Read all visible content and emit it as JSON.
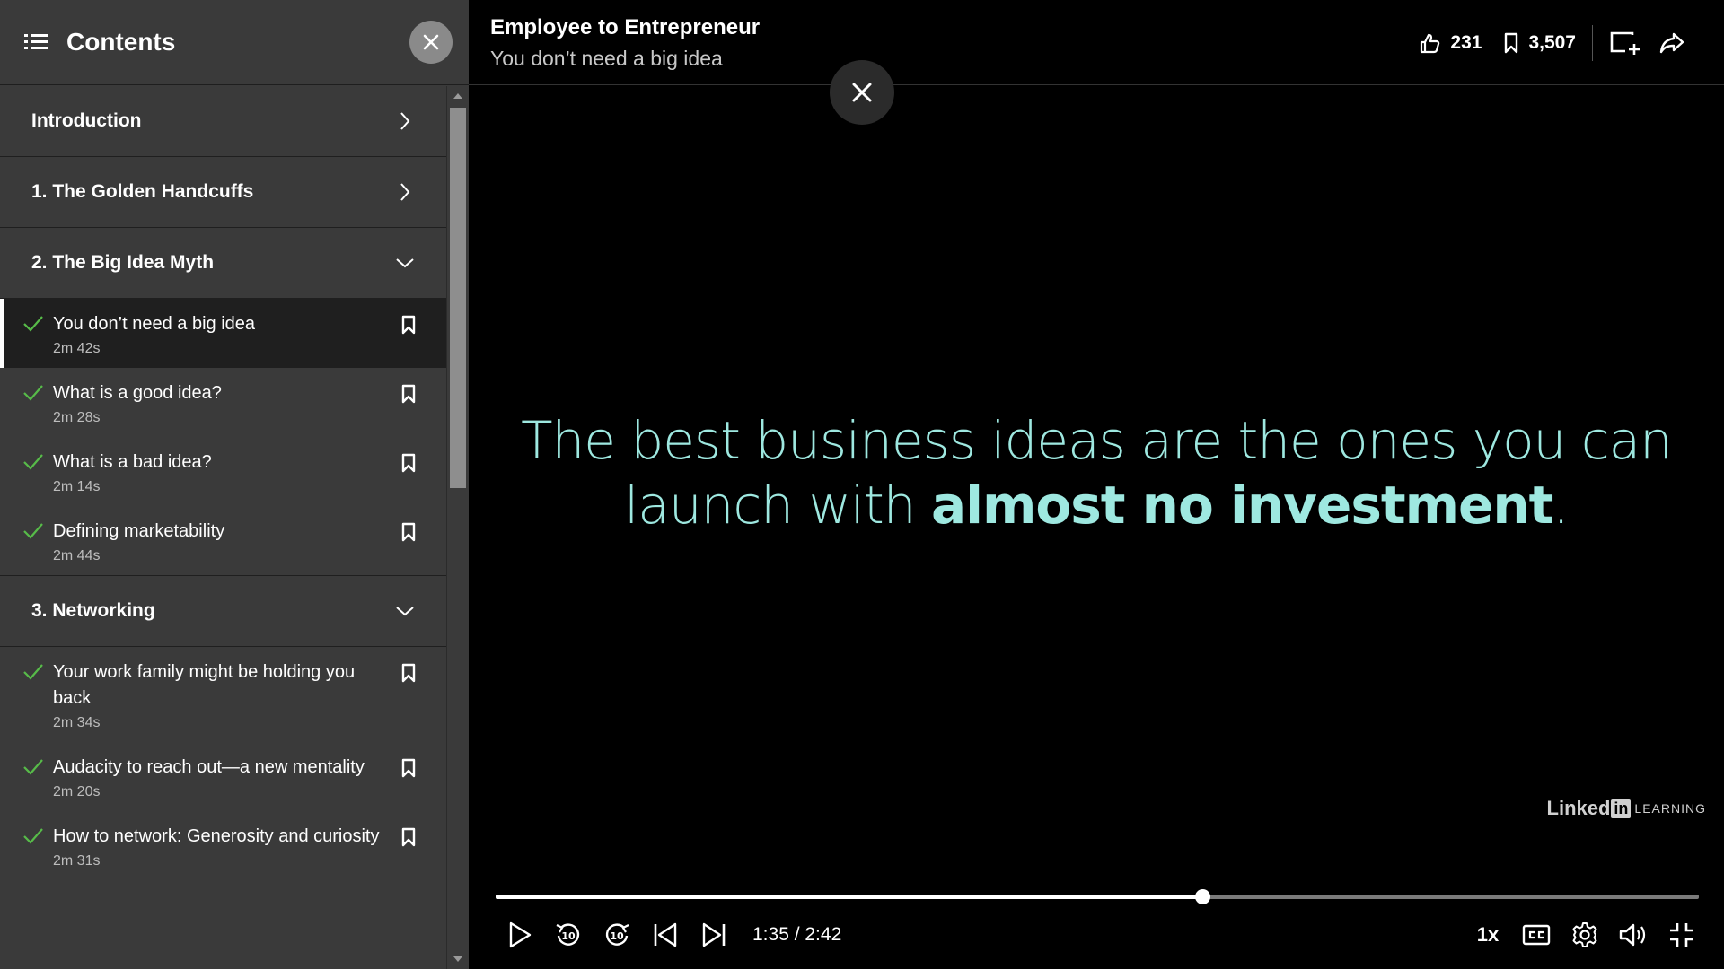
{
  "sidebar": {
    "title": "Contents",
    "sections": [
      {
        "label": "Introduction",
        "state": "collapsed"
      },
      {
        "label": "1. The Golden Handcuffs",
        "state": "collapsed"
      },
      {
        "label": "2. The Big Idea Myth",
        "state": "expanded"
      },
      {
        "label": "3. Networking",
        "state": "expanded"
      }
    ],
    "section2_items": [
      {
        "title": "You don’t need a big idea",
        "duration": "2m 42s",
        "active": true
      },
      {
        "title": "What is a good idea?",
        "duration": "2m 28s"
      },
      {
        "title": "What is a bad idea?",
        "duration": "2m 14s"
      },
      {
        "title": "Defining marketability",
        "duration": "2m 44s"
      }
    ],
    "section3_items": [
      {
        "title": "Your work family might be holding you back",
        "duration": "2m 34s"
      },
      {
        "title": "Audacity to reach out—a new mentality",
        "duration": "2m 20s"
      },
      {
        "title": "How to network: Generosity and curiosity",
        "duration": "2m 31s"
      }
    ]
  },
  "header": {
    "course_title": "Employee to Entrepreneur",
    "video_title": "You don’t need a big idea",
    "likes": "231",
    "saves": "3,507"
  },
  "slide": {
    "text_line1": "The best business ideas are the ones you can",
    "text_line2_prefix": "launch with ",
    "text_line2_bold": "almost no investment",
    "text_line2_suffix": "."
  },
  "logo": {
    "word": "Linked",
    "box": "in",
    "suffix": "LEARNING"
  },
  "player": {
    "time": "1:35 / 2:42",
    "progress": 0.587,
    "speed": "1x"
  },
  "colors": {
    "accent_check": "#57bb49",
    "slide_text": "#9ee8e0"
  }
}
